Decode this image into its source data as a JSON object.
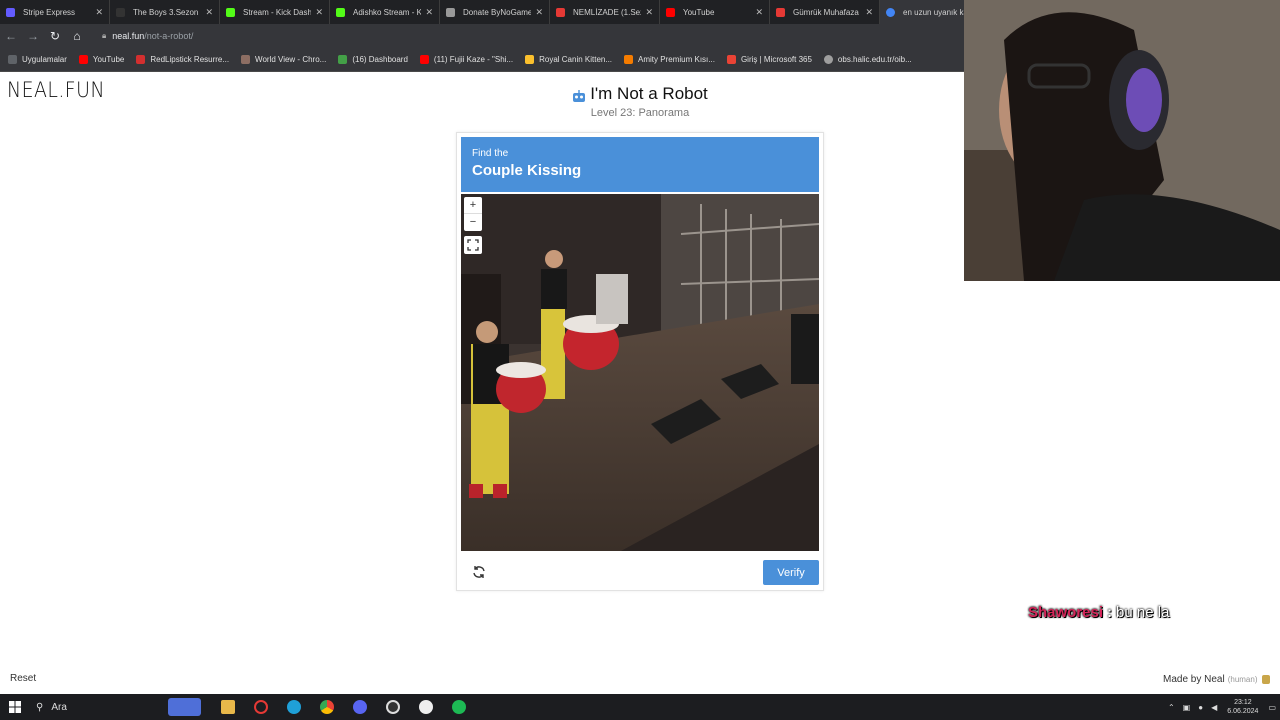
{
  "browser": {
    "tabs": [
      {
        "title": "Stripe Express",
        "color": "#635bff"
      },
      {
        "title": "The Boys 3.Sezon 8.",
        "color": "#222"
      },
      {
        "title": "Stream - Kick Dash",
        "color": "#53fc18"
      },
      {
        "title": "Adishko Stream - Ki",
        "color": "#53fc18"
      },
      {
        "title": "Donate ByNoGame",
        "color": "#999"
      },
      {
        "title": "NEMLİZADE (1.Sez",
        "color": "#e53935"
      },
      {
        "title": "YouTube",
        "color": "#ff0000"
      },
      {
        "title": "Gümrük Muhafaza",
        "color": "#e53935"
      },
      {
        "title": "en uzun uyanık ka",
        "color": "#4285f4"
      }
    ],
    "url_domain": "neal.fun",
    "url_path": "/not-a-robot/",
    "bookmarks": [
      {
        "label": "Uygulamalar",
        "color": "#5f6368"
      },
      {
        "label": "YouTube",
        "color": "#ff0000"
      },
      {
        "label": "RedLipstick Resurre...",
        "color": "#d32f2f"
      },
      {
        "label": "World View - Chro...",
        "color": "#8d6e63"
      },
      {
        "label": "(16) Dashboard",
        "color": "#43a047"
      },
      {
        "label": "(11) Fujii Kaze - \"Shi...",
        "color": "#ff0000"
      },
      {
        "label": "Royal Canin Kitten...",
        "color": "#fbc02d"
      },
      {
        "label": "Amity Premium Kısı...",
        "color": "#f57c00"
      },
      {
        "label": "Giriş | Microsoft 365",
        "color": "#ea4335"
      },
      {
        "label": "obs.halic.edu.tr/oib...",
        "color": "#9e9e9e"
      }
    ]
  },
  "page": {
    "logo": "NEAL.FUN",
    "title": "I'm Not a Robot",
    "subtitle": "Level 23: Panorama",
    "reset": "Reset",
    "made_by": "Made by Neal",
    "made_by_note": "(human)"
  },
  "captcha": {
    "prompt_small": "Find the",
    "prompt_big": "Couple Kissing",
    "zoom_in": "+",
    "zoom_out": "−",
    "verify_label": "Verify"
  },
  "chat": {
    "user": "Shaworesi",
    "separator": ":",
    "message": "bu ne la"
  },
  "taskbar": {
    "search_label": "Ara",
    "time": "23:12",
    "date": "6.06.2024"
  },
  "colors": {
    "accent": "#4a90d9",
    "chat_user": "#d4265a"
  }
}
